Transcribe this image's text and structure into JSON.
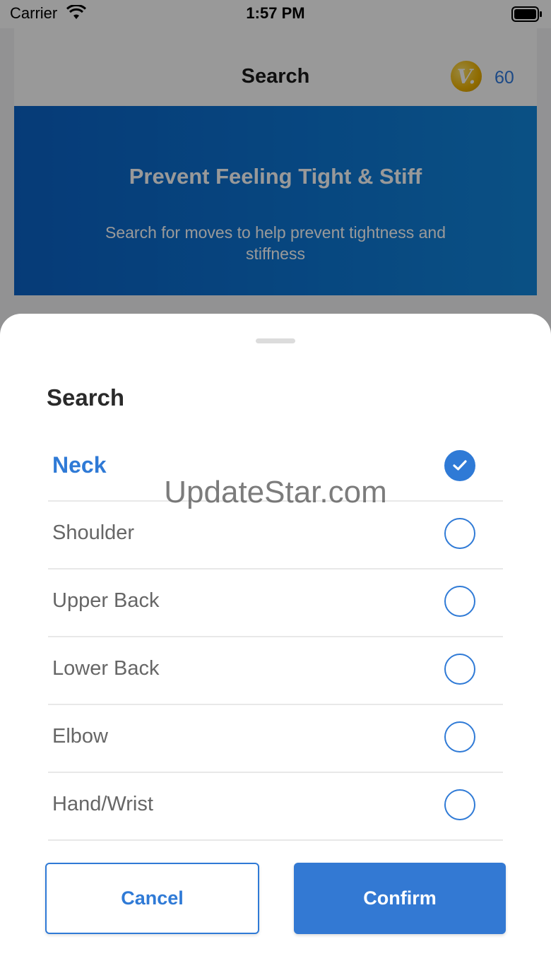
{
  "status_bar": {
    "carrier": "Carrier",
    "time": "1:57 PM"
  },
  "nav": {
    "title": "Search",
    "coin_letter": "V.",
    "coin_count": "60"
  },
  "banner": {
    "title": "Prevent Feeling Tight & Stiff",
    "subtitle": "Search for moves to help prevent tightness and stiffness"
  },
  "sheet": {
    "title": "Search",
    "options": [
      {
        "label": "Neck",
        "selected": true
      },
      {
        "label": "Shoulder",
        "selected": false
      },
      {
        "label": "Upper Back",
        "selected": false
      },
      {
        "label": "Lower Back",
        "selected": false
      },
      {
        "label": "Elbow",
        "selected": false
      },
      {
        "label": "Hand/Wrist",
        "selected": false
      }
    ],
    "cancel_label": "Cancel",
    "confirm_label": "Confirm"
  },
  "watermark": "UpdateStar.com",
  "colors": {
    "accent": "#2f7ad6",
    "banner": "#0d78d6",
    "coin": "#f0b400"
  }
}
